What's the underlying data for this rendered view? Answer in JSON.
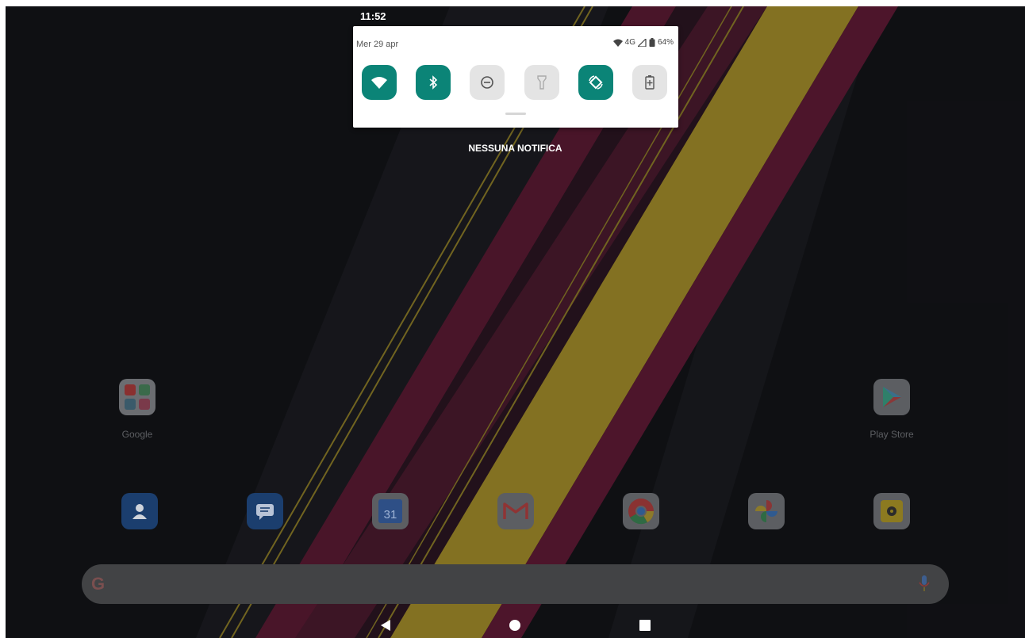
{
  "status_bar": {
    "time": "11:52"
  },
  "quick_settings": {
    "date": "Mer 29 apr",
    "network": "4G",
    "battery": "64%",
    "tiles": [
      {
        "name": "wifi",
        "active": true
      },
      {
        "name": "bluetooth",
        "active": true
      },
      {
        "name": "do-not-disturb",
        "active": false
      },
      {
        "name": "flashlight",
        "active": false
      },
      {
        "name": "auto-rotate",
        "active": true
      },
      {
        "name": "battery-saver",
        "active": false
      }
    ]
  },
  "notifications": {
    "empty_text": "NESSUNA NOTIFICA"
  },
  "home": {
    "folder_label": "Google",
    "play_store_label": "Play Store",
    "dock": [
      "contacts-icon",
      "messages-icon",
      "calendar-icon",
      "gmail-icon",
      "chrome-icon",
      "photos-icon",
      "music-icon"
    ],
    "calendar_day": "31"
  },
  "colors": {
    "tile_active": "#0b8477",
    "tile_inactive": "#e4e4e4"
  }
}
